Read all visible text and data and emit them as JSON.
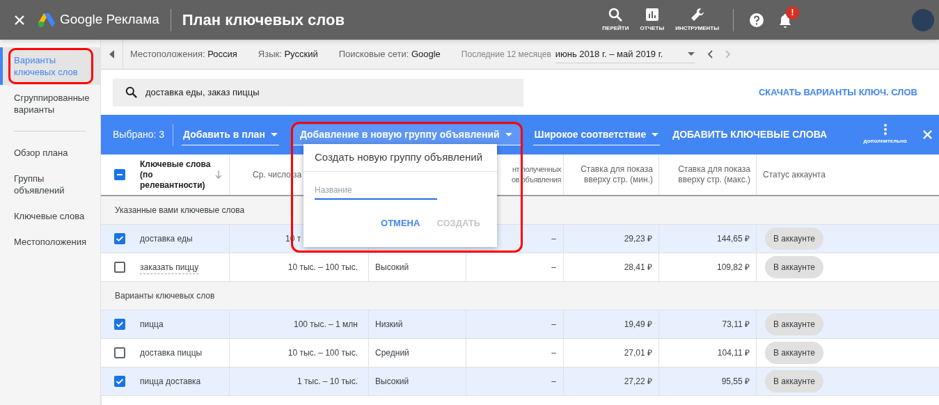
{
  "app_bar": {
    "product": "Google Реклама",
    "title": "План ключевых слов",
    "nav": [
      {
        "label": "ПЕРЕЙТИ",
        "kind": "search"
      },
      {
        "label": "ОТЧЕТЫ",
        "kind": "reports"
      },
      {
        "label": "ИНСТРУМЕНТЫ",
        "kind": "tools"
      }
    ],
    "notification_badge": "!"
  },
  "sidebar": {
    "groups": [
      {
        "items": [
          {
            "label": "Варианты ключевых слов",
            "selected": true,
            "highlighted": true
          },
          {
            "label": "Сгруппированные варианты",
            "selected": false,
            "highlighted": false
          }
        ]
      },
      {
        "items": [
          {
            "label": "Обзор плана",
            "selected": false,
            "highlighted": false
          },
          {
            "label": "Группы объявлений",
            "selected": false,
            "highlighted": false
          },
          {
            "label": "Ключевые слова",
            "selected": false,
            "highlighted": false
          },
          {
            "label": "Местоположения",
            "selected": false,
            "highlighted": false
          }
        ]
      }
    ]
  },
  "filters": [
    {
      "label": "Местоположения:",
      "value": "Россия"
    },
    {
      "label": "Язык:",
      "value": "Русский"
    },
    {
      "label": "Поисковые сети:",
      "value": "Google"
    }
  ],
  "date_range": {
    "label": "Последние 12 месяцев",
    "value": "июнь 2018 г. – май 2019 г."
  },
  "search": {
    "value": "доставка еды, заказ пиццы"
  },
  "download_link": "СКАЧАТЬ ВАРИАНТЫ КЛЮЧ. СЛОВ",
  "toolbar": {
    "selected_count": "Выбрано: 3",
    "dropdowns": [
      {
        "label": "Добавить в план",
        "open": false
      },
      {
        "label": "Добавление в новую группу объявлений",
        "open": true
      },
      {
        "label": "Широкое соответствие",
        "open": false
      }
    ],
    "add_button": "ДОБАВИТЬ КЛЮЧЕВЫЕ СЛОВА",
    "more_label": "дополнительно"
  },
  "popup": {
    "title": "Создать новую группу объявлений",
    "placeholder": "Название",
    "highlighted": true,
    "buttons": [
      {
        "label": "ОТМЕНА",
        "disabled": false
      },
      {
        "label": "СОЗДАТЬ",
        "disabled": true
      }
    ]
  },
  "table": {
    "select_all_partial": true,
    "headers": {
      "keyword": "Ключевые слова (по релевантности)",
      "volume": "Ср. число за",
      "column_4": "нт полученных\nов объявления",
      "bid_low": "Ставка для показа вверху стр. (мин.)",
      "bid_high": "Ставка для показа вверху стр. (макс.)",
      "status": "Статус аккаунта"
    },
    "sections": [
      {
        "title": "Указанные вами ключевые слова",
        "rows": [
          {
            "checked": true,
            "hovered": false,
            "covered": true,
            "keyword": "доставка еды",
            "volume": "10 т",
            "share": "–",
            "bid_low": "29,23 ₽",
            "bid_high": "144,65 ₽",
            "status": "В аккаунте"
          },
          {
            "checked": false,
            "hovered": true,
            "covered": false,
            "keyword": "заказать пиццу",
            "volume": "10 тыс. – 100 тыс.",
            "competition": "Высокий",
            "share": "–",
            "bid_low": "28,41 ₽",
            "bid_high": "109,82 ₽",
            "status": "В аккаунте"
          }
        ]
      },
      {
        "title": "Варианты ключевых слов",
        "rows": [
          {
            "checked": true,
            "hovered": false,
            "covered": false,
            "keyword": "пицца",
            "volume": "100 тыс. – 1 млн",
            "competition": "Низкий",
            "share": "–",
            "bid_low": "19,49 ₽",
            "bid_high": "73,11 ₽",
            "status": "В аккаунте"
          },
          {
            "checked": false,
            "hovered": false,
            "covered": false,
            "keyword": "доставка пиццы",
            "volume": "10 тыс. – 100 тыс.",
            "competition": "Средний",
            "share": "–",
            "bid_low": "27,01 ₽",
            "bid_high": "104,11 ₽",
            "status": "В аккаунте"
          },
          {
            "checked": true,
            "hovered": false,
            "covered": false,
            "keyword": "пицца доставка",
            "volume": "1 тыс. – 10 тыс.",
            "competition": "Высокий",
            "share": "–",
            "bid_low": "27,22 ₽",
            "bid_high": "95,55 ₽",
            "status": "В аккаунте"
          }
        ]
      }
    ]
  }
}
